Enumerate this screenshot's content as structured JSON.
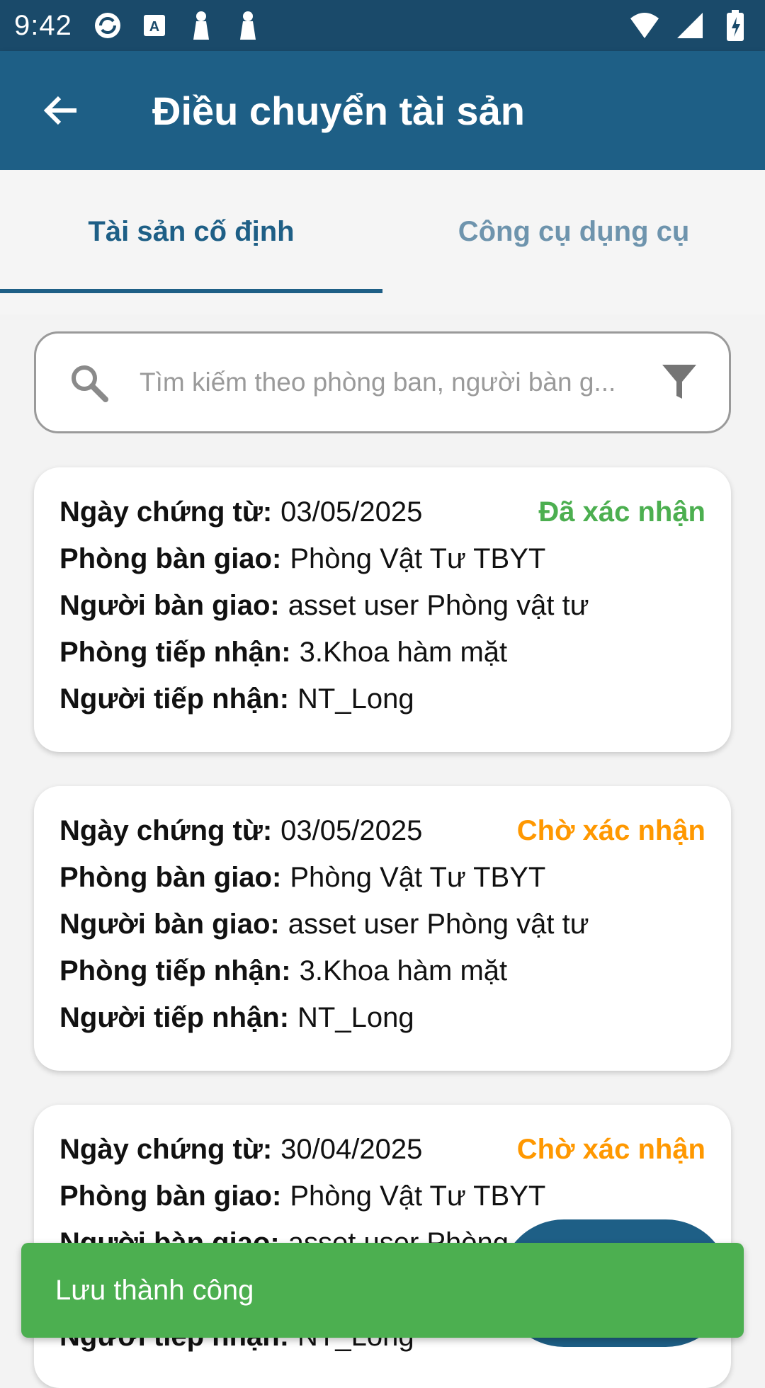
{
  "status_bar": {
    "time": "9:42",
    "left_icons": [
      "sync-icon",
      "keyboard-a-icon",
      "notification-icon",
      "notification-icon"
    ],
    "right_icons": [
      "wifi-icon",
      "signal-icon",
      "battery-charging-icon"
    ]
  },
  "app_bar": {
    "title": "Điều chuyển tài sản",
    "back_icon": "arrow-back-icon"
  },
  "tabs": [
    {
      "label": "Tài sản cố định",
      "active": true
    },
    {
      "label": "Công cụ dụng cụ",
      "active": false
    }
  ],
  "search": {
    "placeholder": "Tìm kiếm theo phòng ban, người bàn g...",
    "value": ""
  },
  "labels": {
    "date": "Ngày chứng từ:",
    "from_dept": "Phòng bàn giao:",
    "from_person": "Người bàn giao:",
    "to_dept": "Phòng tiếp nhận:",
    "to_person": "Người tiếp nhận:"
  },
  "cards": [
    {
      "date": "03/05/2025",
      "status": "Đã xác nhận",
      "from_dept": "Phòng Vật Tư TBYT",
      "from_person": "asset user Phòng vật tư",
      "to_dept": "3.Khoa hàm mặt",
      "to_person": "NT_Long"
    },
    {
      "date": "03/05/2025",
      "status": "Chờ xác nhận",
      "from_dept": "Phòng Vật Tư TBYT",
      "from_person": "asset user Phòng vật tư",
      "to_dept": "3.Khoa hàm mặt",
      "to_person": "NT_Long"
    },
    {
      "date": "30/04/2025",
      "status": "Chờ xác nhận",
      "from_dept": "Phòng Vật Tư TBYT",
      "from_person": "asset user Phòng",
      "to_dept": "",
      "to_person": "NT_Long"
    }
  ],
  "snackbar": {
    "message": "Lưu thành công"
  },
  "colors": {
    "status_bar": "#1a4a6a",
    "primary": "#1e5f86",
    "confirmed": "#4caf50",
    "pending": "#ff9800",
    "snackbar": "#4caf50"
  }
}
